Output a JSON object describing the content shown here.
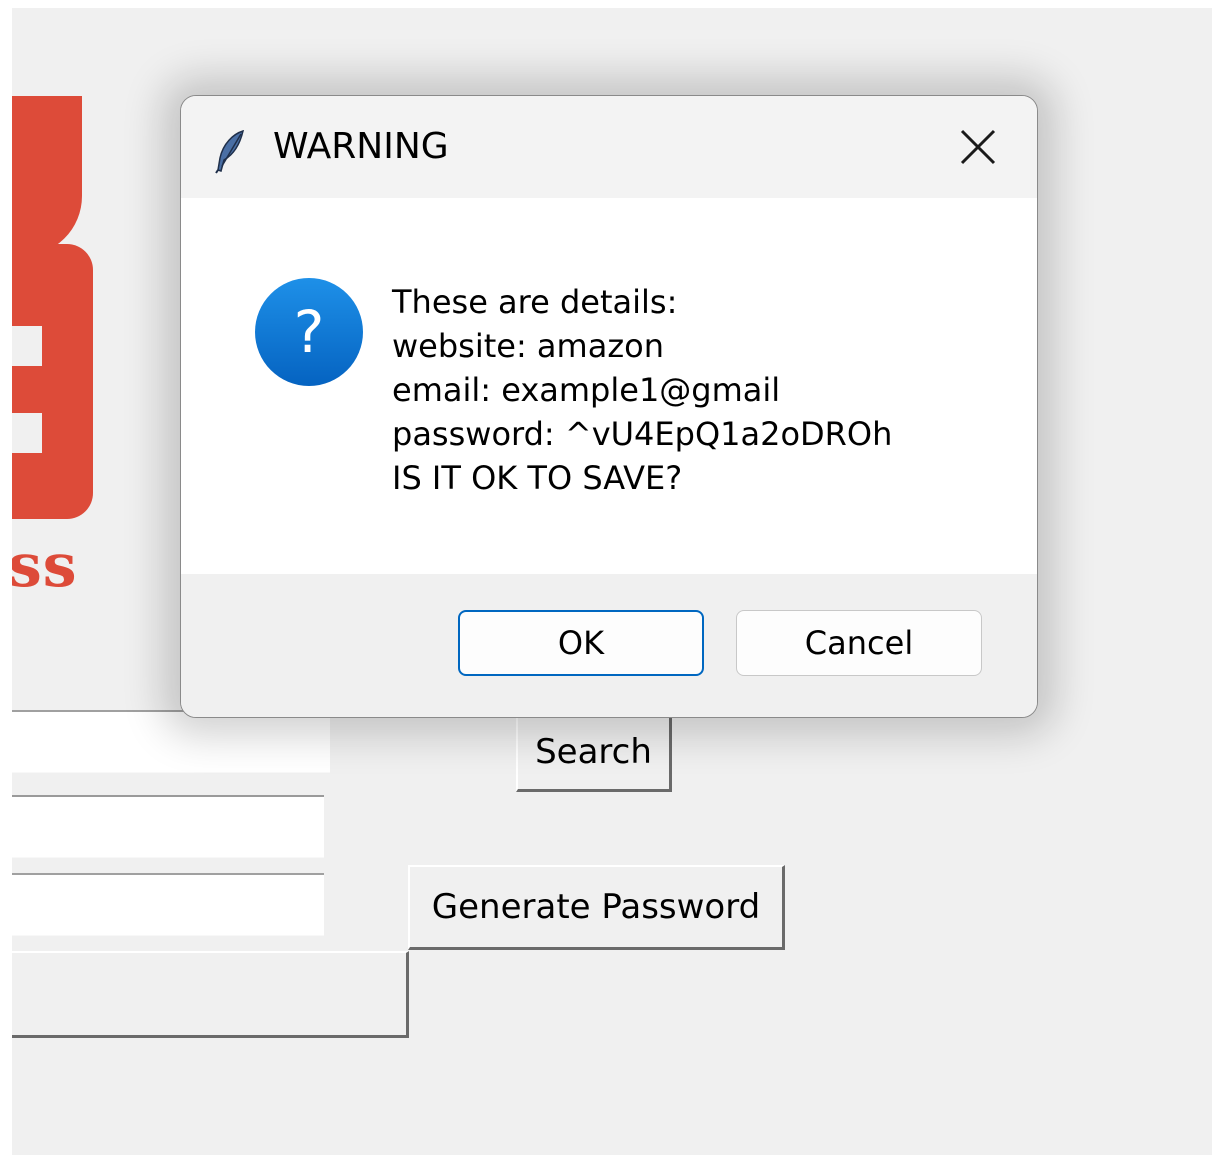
{
  "background": {
    "logo_text": "ss",
    "search_button": "Search",
    "generate_button": "Generate Password"
  },
  "dialog": {
    "title": "WARNING",
    "message_lines": [
      "These are details:",
      "website: amazon",
      "email: example1@gmail",
      "password: ^vU4EpQ1a2oDROh",
      "IS IT OK TO SAVE?"
    ],
    "ok_label": "OK",
    "cancel_label": "Cancel",
    "icons": {
      "title": "feather-icon",
      "message": "question-icon",
      "close": "close-icon"
    }
  },
  "colors": {
    "logo_red": "#dd4b39",
    "question_blue": "#0a78d7",
    "ok_focus_border": "#0067c0"
  }
}
